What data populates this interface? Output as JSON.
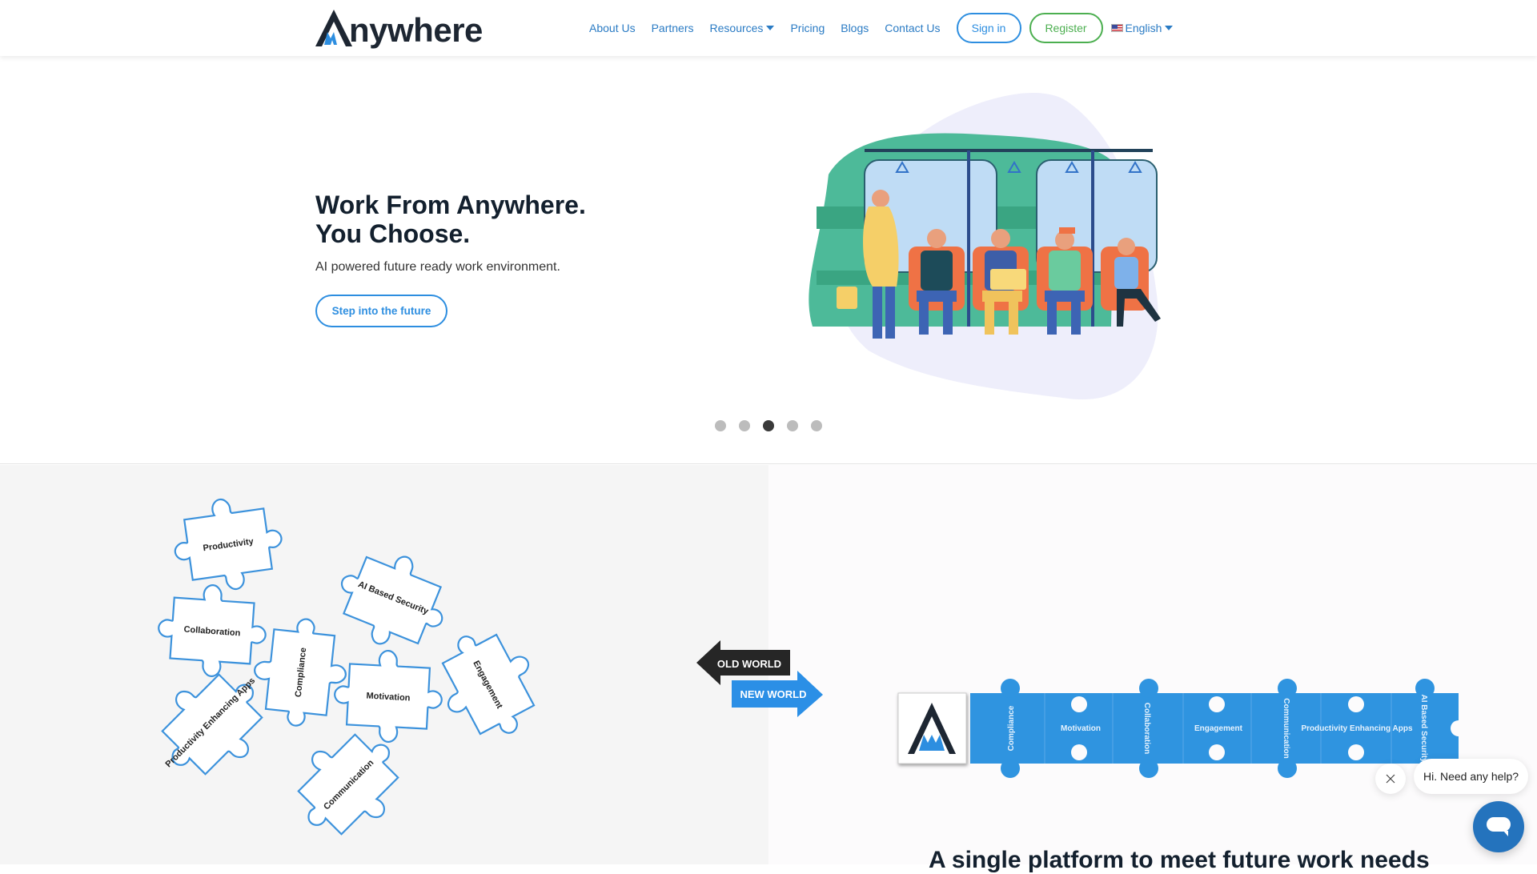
{
  "header": {
    "logo_text": "nywhere",
    "nav": [
      {
        "label": "About Us"
      },
      {
        "label": "Partners"
      },
      {
        "label": "Resources",
        "has_dropdown": true
      },
      {
        "label": "Pricing"
      },
      {
        "label": "Blogs"
      },
      {
        "label": "Contact Us"
      }
    ],
    "signin_label": "Sign in",
    "register_label": "Register",
    "language": "English",
    "language_flag": "us-flag-icon"
  },
  "hero": {
    "title_line1": "Work From Anywhere.",
    "title_line2": "You Choose.",
    "subtitle": "AI powered future ready work environment.",
    "cta_label": "Step into the future",
    "carousel": {
      "total": 5,
      "active_index": 2
    }
  },
  "comparison": {
    "old_world_label": "OLD WORLD",
    "new_world_label": "NEW WORLD",
    "scattered_pieces": [
      "Productivity",
      "Collaboration",
      "AI Based Security",
      "Compliance",
      "Motivation",
      "Engagement",
      "Productivity Enhancing Apps",
      "Communication"
    ],
    "connected_pieces": [
      "Compliance",
      "Motivation",
      "Collaboration",
      "Engagement",
      "Communication",
      "Productivity Enhancing Apps",
      "AI Based Security"
    ]
  },
  "section": {
    "title": "A single platform to meet future work needs"
  },
  "chat": {
    "greeting": "Hi. Need any help?"
  },
  "colors": {
    "brand_blue": "#2d8ee0",
    "nav_blue": "#2a7bc4",
    "register_green": "#4caf50",
    "dark_text": "#13202e",
    "puzzle_blue": "#2f94e0",
    "chat_blue": "#2473bd"
  }
}
